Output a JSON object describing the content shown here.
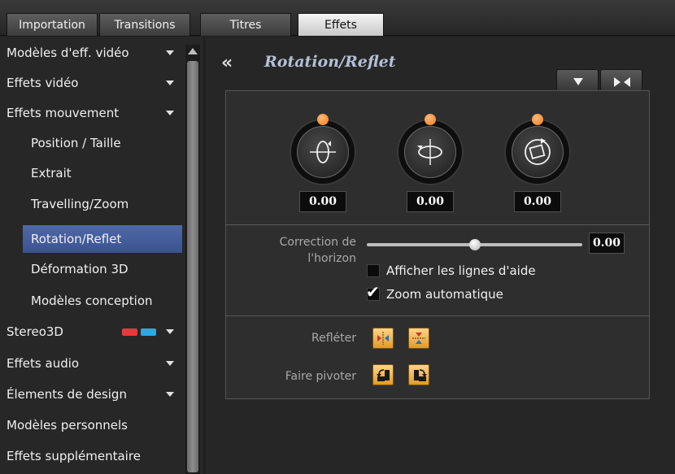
{
  "tabs": [
    {
      "label": "Importation",
      "active": false
    },
    {
      "label": "Transitions",
      "active": false
    },
    {
      "label": "Titres",
      "active": false
    },
    {
      "label": "Effets",
      "active": true
    }
  ],
  "sidebar": {
    "items": [
      {
        "label": "Modèles d'eff. vidéo",
        "level": 0,
        "expandable": true
      },
      {
        "label": "Effets vidéo",
        "level": 0,
        "expandable": true
      },
      {
        "label": "Effets mouvement",
        "level": 0,
        "expandable": true
      },
      {
        "label": "Position / Taille",
        "level": 1
      },
      {
        "label": "Extrait",
        "level": 1
      },
      {
        "label": "Travelling/Zoom",
        "level": 1
      },
      {
        "label": "Rotation/Reflet",
        "level": 1,
        "selected": true
      },
      {
        "label": "Déformation 3D",
        "level": 1
      },
      {
        "label": "Modèles conception",
        "level": 1
      },
      {
        "label": "Stereo3D",
        "level": 0,
        "expandable": true,
        "icon": "stereo-3d-glasses-icon"
      },
      {
        "label": "Effets audio",
        "level": 0,
        "expandable": true
      },
      {
        "label": "Élements de design",
        "level": 0,
        "expandable": true
      },
      {
        "label": "Modèles personnels",
        "level": 0
      },
      {
        "label": "Effets supplémentaire",
        "level": 0
      }
    ]
  },
  "panel": {
    "back_icon": "double-chevron-left-icon",
    "title": "Rotation/Reflet",
    "menu_icon": "triangle-down-icon",
    "collapse_icon": "arrows-inward-icon",
    "dials": [
      {
        "icon": "rotate-x-axis-icon",
        "value": "0.00"
      },
      {
        "icon": "rotate-y-axis-icon",
        "value": "0.00"
      },
      {
        "icon": "rotate-z-axis-icon",
        "value": "0.00"
      }
    ],
    "horizon": {
      "label_line1": "Correction de",
      "label_line2": "l'horizon",
      "value": "0.00",
      "slider_fraction": 0.5
    },
    "show_guides_label": "Afficher les lignes d'aide",
    "show_guides_checked": false,
    "auto_zoom_label": "Zoom automatique",
    "auto_zoom_checked": true,
    "mirror_label": "Refléter",
    "rotate_label": "Faire pivoter"
  },
  "colors": {
    "accent_orange": "#f07a1a",
    "selection_blue": "#4a64a2",
    "title_color": "#b4c0d6",
    "stereo_red": "#e33b3b",
    "stereo_cyan": "#2fa8e0"
  }
}
